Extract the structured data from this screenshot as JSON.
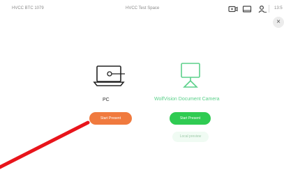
{
  "topbar": {
    "left_title": "HVCC BTC 1079",
    "center_title": "HVCC Test Space",
    "time": "13:5"
  },
  "sources": [
    {
      "label": "PC",
      "button_label": "Start Present"
    },
    {
      "label": "WolfVision Document Camera",
      "button_label": "Start Present",
      "secondary_label": "Local preview"
    }
  ],
  "colors": {
    "orange_button": "#f07a3e",
    "green_button": "#2fcb52",
    "camera_accent": "#5bd08a",
    "laser": "#e8141b"
  },
  "icons": {
    "video": "video-camera-icon",
    "screen": "screen-share-icon",
    "person": "person-icon",
    "close": "close-icon",
    "close_glyph": "×"
  }
}
